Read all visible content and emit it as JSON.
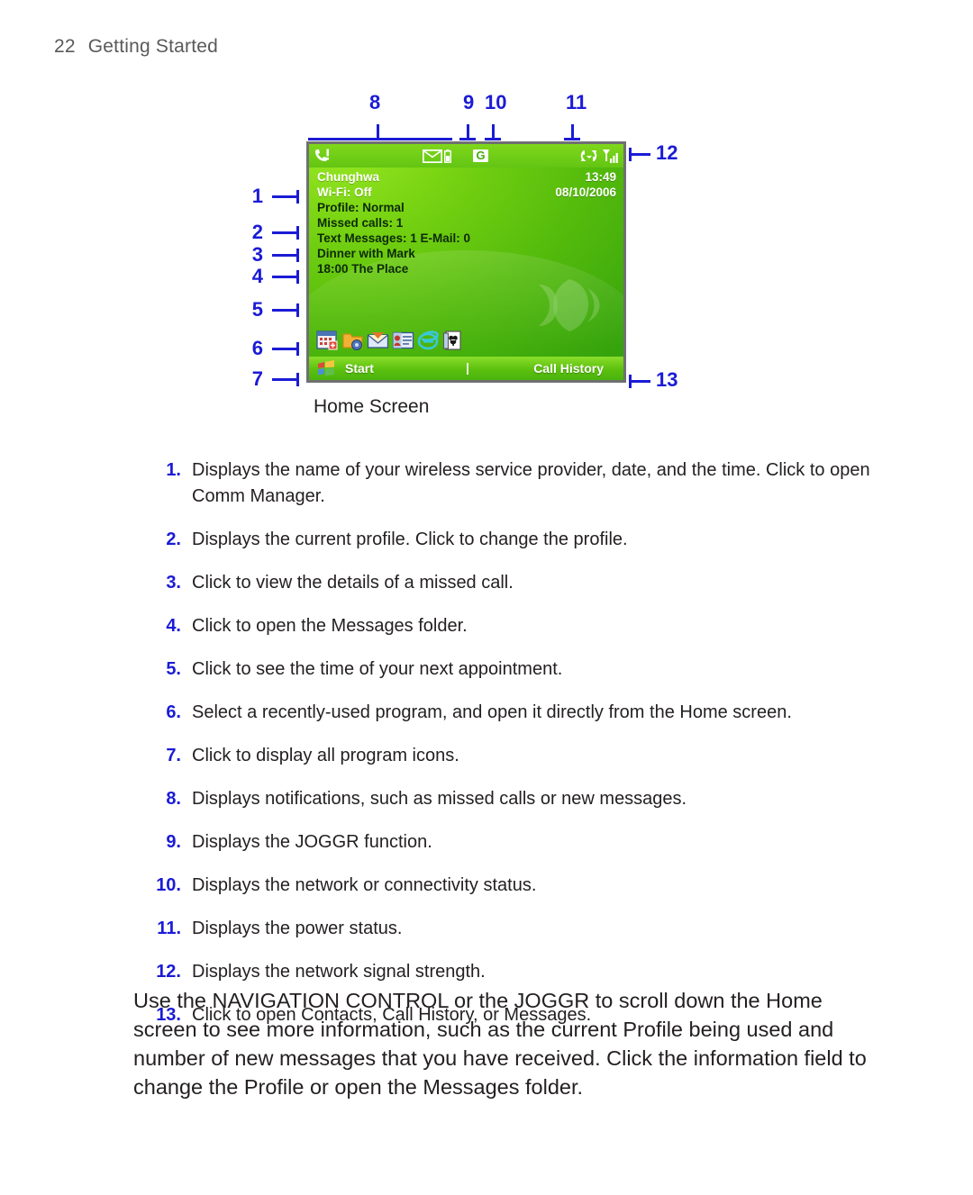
{
  "runhead": {
    "page_number": "22",
    "section": "Getting Started"
  },
  "figure": {
    "caption": "Home Screen",
    "top_callouts": [
      "8",
      "9",
      "10",
      "11"
    ],
    "side_callouts": [
      "1",
      "2",
      "3",
      "4",
      "5",
      "6",
      "7"
    ],
    "right_callouts": [
      "12",
      "13"
    ],
    "screen": {
      "status_icons": [
        "missed-call-icon",
        "new-message-icon",
        "battery-icon",
        "gprs-icon",
        "sync-icon",
        "signal-strength-icon"
      ],
      "gprs_label": "G",
      "operator": "Chunghwa",
      "time": "13:49",
      "wifi": "Wi-Fi: Off",
      "date": "08/10/2006",
      "profile": "Profile: Normal",
      "missed_calls": "Missed calls: 1",
      "messages": "Text Messages: 1   E-Mail: 0",
      "appointment_title": "Dinner with Mark",
      "appointment_time": "18:00 The Place",
      "program_icons": [
        "calendar-icon",
        "settings-folder-icon",
        "messaging-icon",
        "contacts-icon",
        "internet-explorer-icon",
        "solitaire-icon"
      ],
      "taskbar": {
        "start_label": "Start",
        "right_label": "Call History",
        "start_icon": "windows-flag-icon"
      }
    },
    "colors": {
      "callout_blue": "#1b1bd6",
      "screen_green_light": "#9ae824",
      "screen_green_dark": "#35a30c"
    }
  },
  "list": [
    {
      "n": "1.",
      "text": "Displays the name of your wireless service provider, date, and the time. Click to open Comm Manager."
    },
    {
      "n": "2.",
      "text": "Displays the current profile. Click to change the profile."
    },
    {
      "n": "3.",
      "text": "Click to view the details of a missed call."
    },
    {
      "n": "4.",
      "text": "Click to open the Messages folder."
    },
    {
      "n": "5.",
      "text": "Click to see the time of your next appointment."
    },
    {
      "n": "6.",
      "text": "Select a recently-used program, and open it directly from the Home screen."
    },
    {
      "n": "7.",
      "text": "Click to display all program icons."
    },
    {
      "n": "8.",
      "text": "Displays notifications, such as missed calls or new messages."
    },
    {
      "n": "9.",
      "text": "Displays the JOGGR function."
    },
    {
      "n": "10.",
      "text": "Displays the network or connectivity status."
    },
    {
      "n": "11.",
      "text": "Displays the power status."
    },
    {
      "n": "12.",
      "text": "Displays the network signal strength."
    },
    {
      "n": "13.",
      "text": "Click to open Contacts, Call History, or Messages."
    }
  ],
  "closing": "Use the NAVIGATION CONTROL or the JOGGR to scroll down the Home screen to see more information, such as the current Profile being used and number of new messages that you have received. Click the information field to change the Profile or open the Messages folder."
}
